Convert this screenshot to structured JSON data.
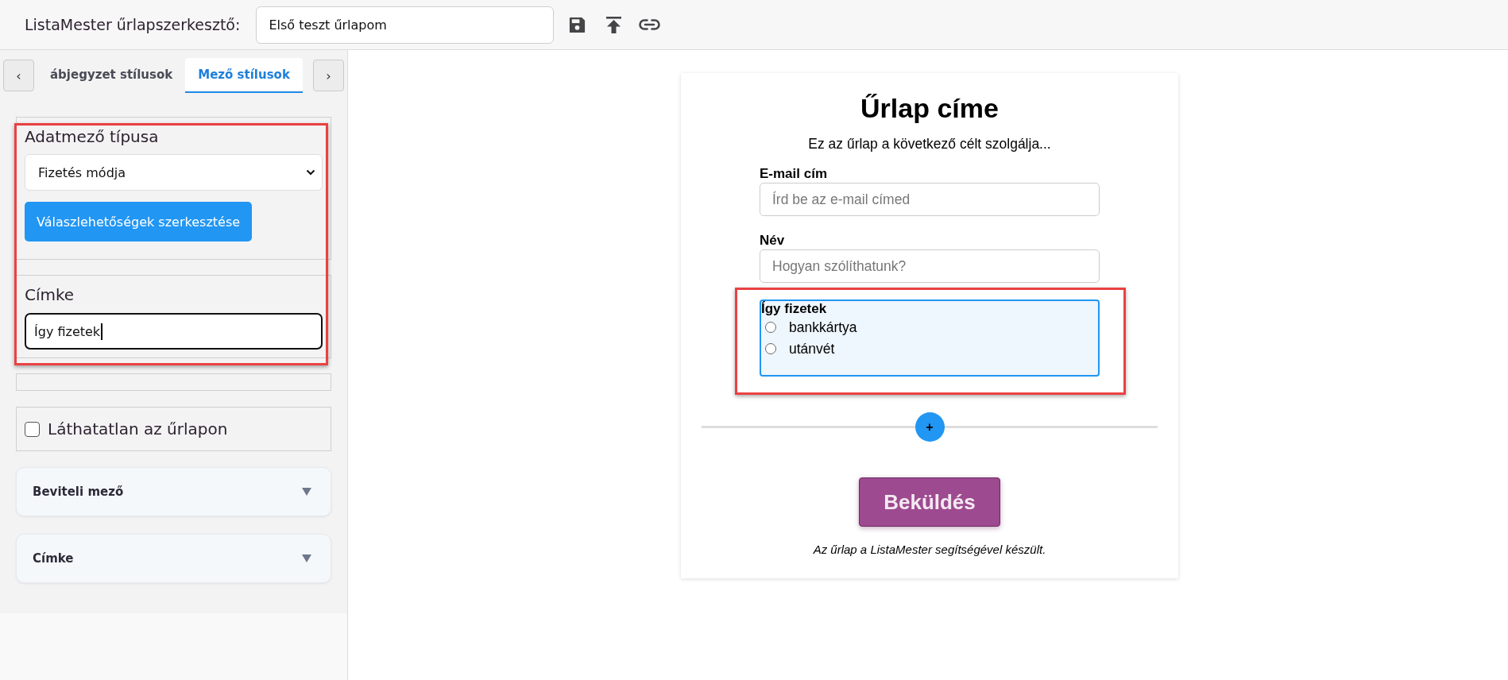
{
  "header": {
    "title": "ListaMester űrlapszerkesztő:",
    "form_name": "Első teszt űrlapom"
  },
  "sidebar": {
    "tab_scroll": {
      "left": "‹",
      "right": "›"
    },
    "tabs": [
      {
        "label": "ábjegyzet stílusok",
        "selected": false
      },
      {
        "label": "Mező stílusok",
        "selected": true
      }
    ],
    "field_settings": {
      "highlighted": true,
      "field_type": {
        "label": "Adatmező típusa",
        "value": "Fizetés módja"
      },
      "edit_options_button": "Válaszlehetőségek szerkesztése",
      "label_field": {
        "label": "Címke",
        "value": "Így fizetek",
        "focused": true
      }
    },
    "hidden_checkbox": {
      "label": "Láthatatlan az űrlapon",
      "checked": false
    },
    "accordions": [
      {
        "title": "Beviteli mező",
        "expanded": false
      },
      {
        "title": "Címke",
        "expanded": false
      }
    ]
  },
  "form": {
    "title": "Űrlap címe",
    "description": "Ez az űrlap a következő célt szolgálja...",
    "fields": [
      {
        "kind": "text",
        "label": "E-mail cím",
        "placeholder": "Írd be az e-mail címed",
        "selected": false
      },
      {
        "kind": "text",
        "label": "Név",
        "placeholder": "Hogyan szólíthatunk?",
        "selected": false
      },
      {
        "kind": "radio",
        "label": "Így fizetek",
        "selected": true,
        "highlighted": true,
        "options": [
          {
            "label": "bankkártya",
            "checked": false
          },
          {
            "label": "utánvét",
            "checked": false
          }
        ]
      }
    ],
    "add_button": "+",
    "submit_button": "Beküldés",
    "footer": "Az űrlap a ListaMester segítségével készült."
  }
}
